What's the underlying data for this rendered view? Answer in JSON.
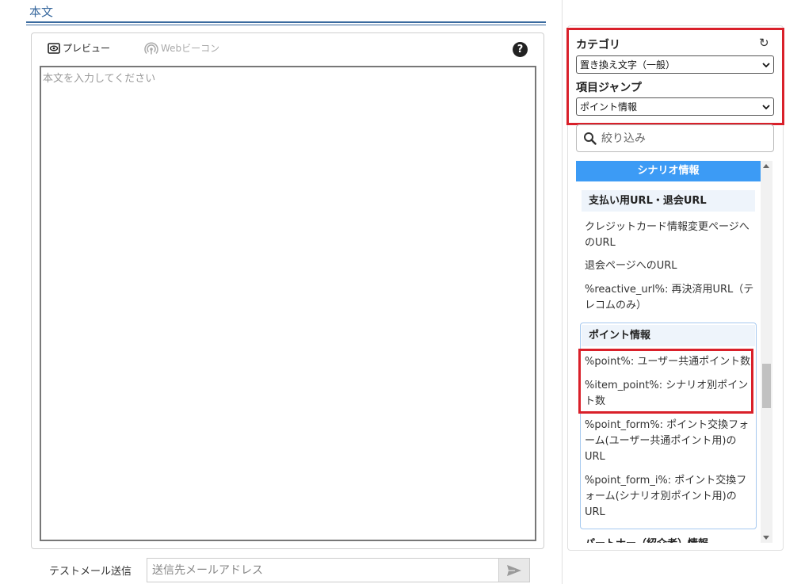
{
  "main": {
    "section_title": "本文",
    "toolbar": {
      "preview_label": "プレビュー",
      "beacon_label": "Webビーコン",
      "help_icon": "question-circle-icon"
    },
    "body_placeholder": "本文を入力してください",
    "test_mail": {
      "label": "テストメール送信",
      "placeholder": "送信先メールアドレス",
      "send_icon": "paper-plane-icon"
    }
  },
  "sidebar": {
    "category_label": "カテゴリ",
    "category_value": "置き換え文字（一般）",
    "jump_label": "項目ジャンプ",
    "jump_value": "ポイント情報",
    "filter_placeholder": "絞り込み",
    "scenario_header": "シナリオ情報",
    "groups": {
      "payment": {
        "heading": "支払い用URL・退会URL",
        "items": [
          "クレジットカード情報変更ページへのURL",
          "退会ページへのURL",
          "%reactive_url%: 再決済用URL（テレコムのみ）"
        ]
      },
      "point": {
        "heading": "ポイント情報",
        "items": [
          "%point%: ユーザー共通ポイント数",
          "%item_point%: シナリオ別ポイント数",
          "%point_form%: ポイント交換フォーム(ユーザー共通ポイント用)のURL",
          "%point_form_i%: ポイント交換フォーム(シナリオ別ポイント用)のURL"
        ]
      },
      "partner_heading": "パートナー（紹介者）情報"
    }
  },
  "colors": {
    "accent": "#3c9bf5",
    "title": "#3a6a9f",
    "highlight_border": "#d9202a"
  }
}
